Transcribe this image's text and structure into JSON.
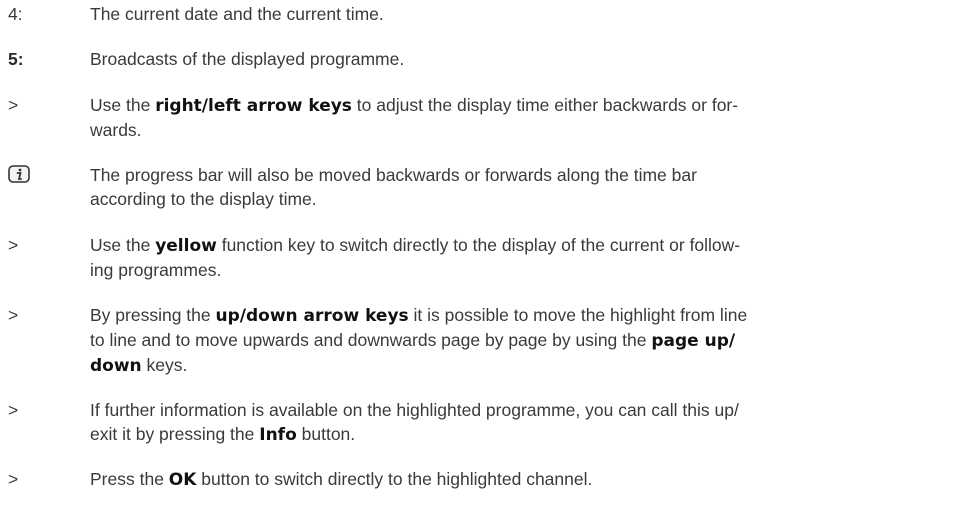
{
  "items": [
    {
      "marker": "4:",
      "parts": [
        "The current date and the current time."
      ]
    },
    {
      "marker": "5:",
      "parts": [
        "Broadcasts of the displayed programme."
      ]
    },
    {
      "marker": ">",
      "parts": [
        "Use the ",
        "right/left arrow keys",
        " to adjust the display time either backwards or for-",
        "wards."
      ]
    },
    {
      "marker_icon": "info-icon",
      "parts": [
        "The progress bar will also be moved backwards or forwards along the time bar",
        "according to the display time."
      ]
    },
    {
      "marker": ">",
      "parts": [
        "Use the ",
        "yellow",
        " function key to switch directly to the display of the current or follow-",
        "ing programmes."
      ]
    },
    {
      "marker": ">",
      "parts": [
        "By pressing the ",
        "up/down arrow keys",
        " it is possible to move the highlight from line",
        "to line and to move upwards and downwards page by page by using the ",
        "page up/",
        "down",
        " keys."
      ]
    },
    {
      "marker": ">",
      "parts": [
        "If further information is available on the highlighted programme, you can call this up/",
        "exit it by pressing the ",
        "Info",
        " button."
      ]
    },
    {
      "marker": ">",
      "parts": [
        "Press the ",
        "OK",
        " button to switch directly to the highlighted channel."
      ]
    }
  ]
}
